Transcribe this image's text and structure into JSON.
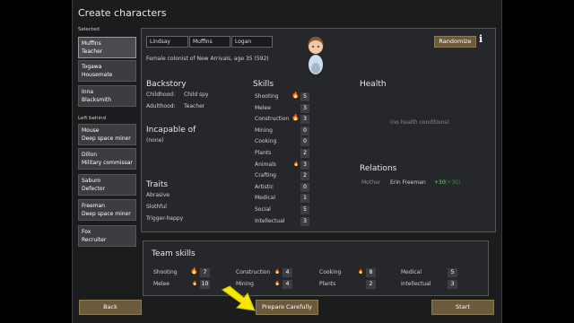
{
  "window": {
    "title": "Create characters"
  },
  "selected_label": "Selected",
  "left_behind_label": "Left behind",
  "selected": [
    {
      "name": "Muffins",
      "role": "Teacher"
    },
    {
      "name": "Togawa",
      "role": "Housemate"
    },
    {
      "name": "Inna",
      "role": "Blacksmith"
    }
  ],
  "left_behind": [
    {
      "name": "Mouse",
      "role": "Deep space miner"
    },
    {
      "name": "Dillon",
      "role": "Military commissar"
    },
    {
      "name": "Saburo",
      "role": "Defector"
    },
    {
      "name": "Freeman",
      "role": "Deep space miner"
    },
    {
      "name": "Fox",
      "role": "Recruiter"
    }
  ],
  "pawn": {
    "first": "Lindsay",
    "nick": "Muffins",
    "last": "Logan",
    "description": "Female colonist of New Arrivals, age 35 (592)",
    "randomize_label": "Randomize",
    "info_glyph": "i"
  },
  "backstory": {
    "header": "Backstory",
    "childhood_label": "Childhood:",
    "childhood": "Child spy",
    "adulthood_label": "Adulthood:",
    "adulthood": "Teacher"
  },
  "incapable": {
    "header": "Incapable of",
    "value": "(none)"
  },
  "traits": {
    "header": "Traits",
    "items": [
      "Abrasive",
      "Slothful",
      "Trigger-happy"
    ]
  },
  "skills": {
    "header": "Skills",
    "items": [
      {
        "name": "Shooting",
        "passion": "major",
        "value": "5"
      },
      {
        "name": "Melee",
        "passion": "",
        "value": "3"
      },
      {
        "name": "Construction",
        "passion": "major",
        "value": "3"
      },
      {
        "name": "Mining",
        "passion": "",
        "value": "0"
      },
      {
        "name": "Cooking",
        "passion": "",
        "value": "0"
      },
      {
        "name": "Plants",
        "passion": "",
        "value": "2"
      },
      {
        "name": "Animals",
        "passion": "minor",
        "value": "3"
      },
      {
        "name": "Crafting",
        "passion": "",
        "value": "2"
      },
      {
        "name": "Artistic",
        "passion": "",
        "value": "0"
      },
      {
        "name": "Medical",
        "passion": "",
        "value": "1"
      },
      {
        "name": "Social",
        "passion": "",
        "value": "5"
      },
      {
        "name": "Intellectual",
        "passion": "",
        "value": "3"
      }
    ]
  },
  "health": {
    "header": "Health",
    "value": "(no health conditions)"
  },
  "relations": {
    "header": "Relations",
    "relation": "Mother",
    "name": "Erin Freeman",
    "opinion": "+30",
    "opinion2": "(+30)"
  },
  "team": {
    "header": "Team skills",
    "items": [
      {
        "name": "Shooting",
        "passion": "major",
        "value": "7"
      },
      {
        "name": "Construction",
        "passion": "minor",
        "value": "4"
      },
      {
        "name": "Cooking",
        "passion": "minor",
        "value": "8"
      },
      {
        "name": "Medical",
        "passion": "",
        "value": "5"
      },
      {
        "name": "Melee",
        "passion": "minor",
        "value": "10"
      },
      {
        "name": "Mining",
        "passion": "minor",
        "value": "4"
      },
      {
        "name": "Plants",
        "passion": "",
        "value": "2"
      },
      {
        "name": "Intellectual",
        "passion": "",
        "value": "3"
      }
    ]
  },
  "buttons": {
    "back": "Back",
    "prepare": "Prepare Carefully",
    "start": "Start"
  },
  "colors": {
    "button": "#6b5a3c",
    "passion": "#f0a020",
    "arrow": "#f5e900",
    "opinion": "#6fd36f"
  }
}
